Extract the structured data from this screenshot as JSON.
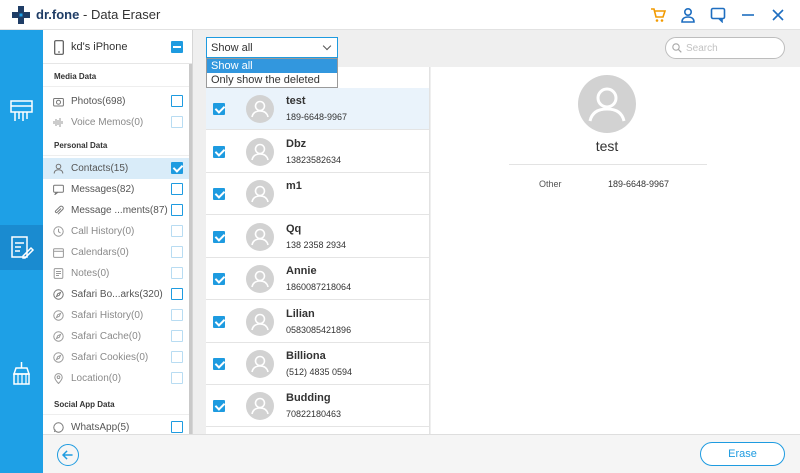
{
  "app": {
    "brand": "dr.fone",
    "separator": "-",
    "title": "Data Eraser"
  },
  "device": {
    "name": "kd's iPhone"
  },
  "sections": {
    "media": "Media Data",
    "personal": "Personal Data",
    "social": "Social App Data"
  },
  "categories": [
    {
      "label": "Photos(698)",
      "state": "empty"
    },
    {
      "label": "Voice Memos(0)",
      "state": "dim"
    },
    {
      "label": "Contacts(15)",
      "state": "checked"
    },
    {
      "label": "Messages(82)",
      "state": "empty"
    },
    {
      "label": "Message ...ments(87)",
      "state": "empty"
    },
    {
      "label": "Call History(0)",
      "state": "dim"
    },
    {
      "label": "Calendars(0)",
      "state": "dim"
    },
    {
      "label": "Notes(0)",
      "state": "dim"
    },
    {
      "label": "Safari Bo...arks(320)",
      "state": "empty"
    },
    {
      "label": "Safari History(0)",
      "state": "dim"
    },
    {
      "label": "Safari Cache(0)",
      "state": "dim"
    },
    {
      "label": "Safari Cookies(0)",
      "state": "dim"
    },
    {
      "label": "Location(0)",
      "state": "dim"
    },
    {
      "label": "WhatsApp(5)",
      "state": "empty"
    }
  ],
  "filter": {
    "selected": "Show all",
    "options": [
      "Show all",
      "Only show the deleted"
    ]
  },
  "search": {
    "placeholder": "Search"
  },
  "contacts": [
    {
      "name": "test",
      "phone": "189-6648-9967"
    },
    {
      "name": "Dbz",
      "phone": "13823582634"
    },
    {
      "name": "m1",
      "phone": ""
    },
    {
      "name": "Qq",
      "phone": "138 2358 2934"
    },
    {
      "name": "Annie",
      "phone": "1860087218064"
    },
    {
      "name": "Lilian",
      "phone": "0583085421896"
    },
    {
      "name": "Billiona",
      "phone": "(512) 4835 0594"
    },
    {
      "name": "Budding",
      "phone": "70822180463"
    }
  ],
  "detail": {
    "name": "test",
    "field_label": "Other",
    "field_value": "189-6648-9967"
  },
  "buttons": {
    "erase": "Erase"
  },
  "colors": {
    "accent": "#1e9be0",
    "nav": "#1ea0e6",
    "selected_row": "#d9ecf9"
  }
}
